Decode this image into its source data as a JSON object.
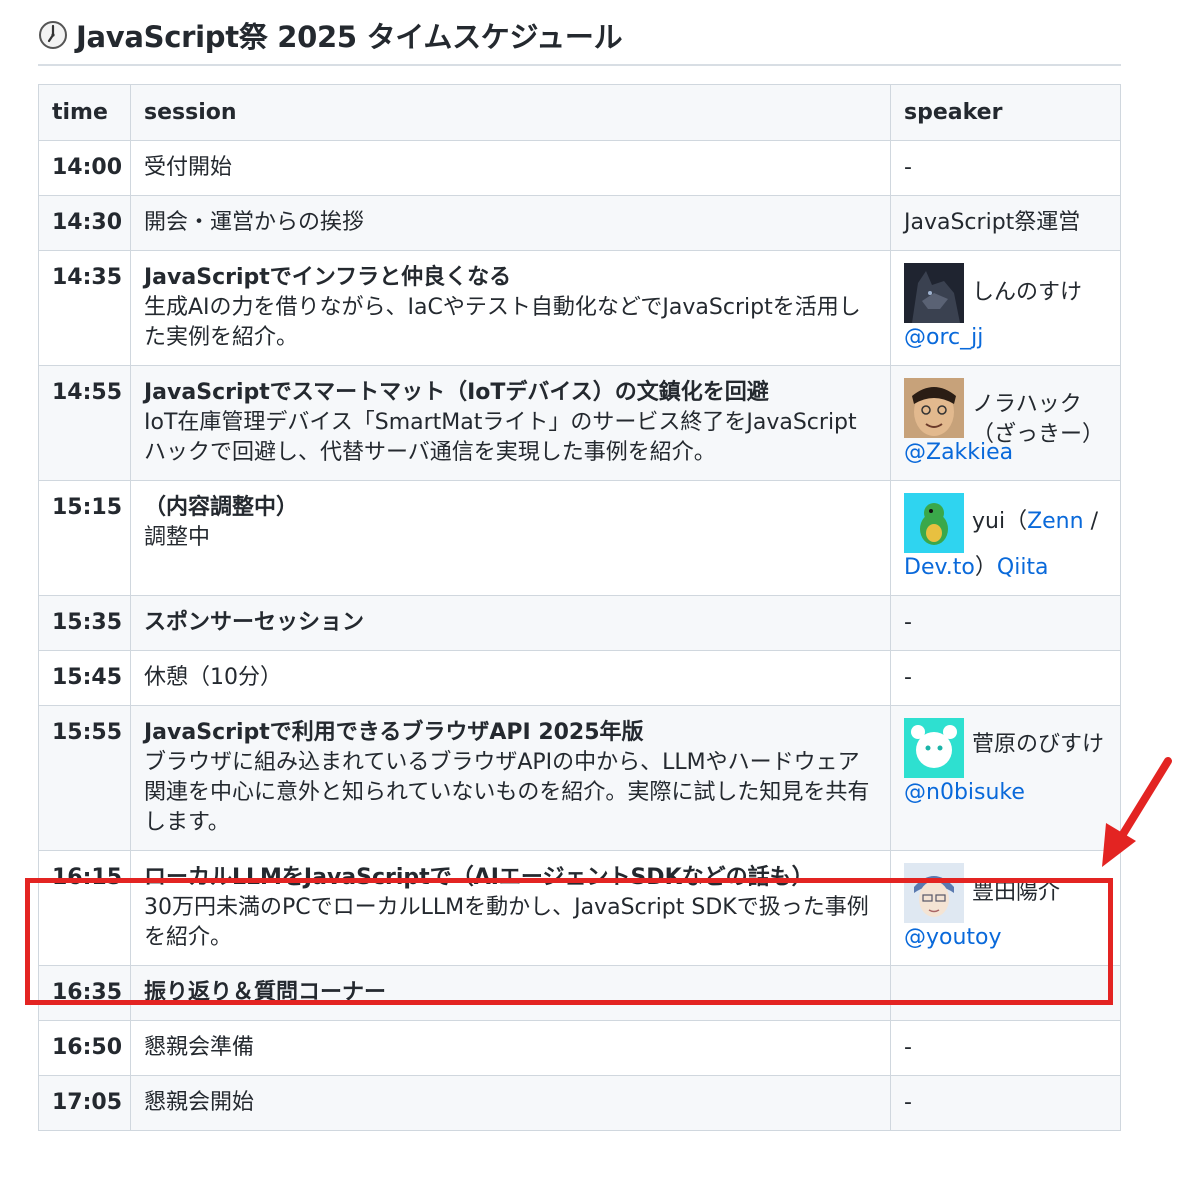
{
  "page": {
    "icon": "clock-icon",
    "title": "JavaScript祭 2025 タイムスケジュール"
  },
  "table": {
    "headers": [
      "time",
      "session",
      "speaker"
    ],
    "rows": [
      {
        "time": "14:00",
        "title": "",
        "desc": "受付開始",
        "speaker": "-"
      },
      {
        "time": "14:30",
        "title": "",
        "desc": "開会・運営からの挨拶",
        "speaker": "JavaScript祭運営"
      },
      {
        "time": "14:35",
        "title": "JavaScriptでインフラと仲良くなる",
        "desc": "生成AIの力を借りながら、IaCやテスト自動化などでJavaScriptを活用した実例を紹介。",
        "speaker": "しんのすけ",
        "handle": "@orc_jj",
        "avatar": "wolf-avatar"
      },
      {
        "time": "14:55",
        "title": "JavaScriptでスマートマット（IoTデバイス）の文鎮化を回避",
        "desc": "IoT在庫管理デバイス「SmartMatライト」のサービス終了をJavaScriptハックで回避し、代替サーバ通信を実現した事例を紹介。",
        "speaker": "ノラハック（ざっきー）",
        "handle": "@Zakkiea",
        "avatar": "man-photo-avatar"
      },
      {
        "time": "15:15",
        "title": "（内容調整中）",
        "desc": "調整中",
        "speaker": "yui（",
        "link1": "Zenn",
        "sep": " / ",
        "link2": "Dev.to",
        "close": "）",
        "link3": "Qiita",
        "avatar": "dinosaur-avatar"
      },
      {
        "time": "15:35",
        "title": "スポンサーセッション",
        "desc": "",
        "speaker": "-"
      },
      {
        "time": "15:45",
        "title": "",
        "desc": "休憩（10分）",
        "speaker": "-"
      },
      {
        "time": "15:55",
        "title": "JavaScriptで利用できるブラウザAPI 2025年版",
        "desc": "ブラウザに組み込まれているブラウザAPIの中から、LLMやハードウェア関連を中心に意外と知られていないものを紹介。実際に試した知見を共有します。",
        "speaker": "菅原のびすけ",
        "handle": "@n0bisuke",
        "avatar": "cat-avatar"
      },
      {
        "time": "16:15",
        "title": "ローカルLLMをJavaScriptで（AIエージェントSDKなどの話も）",
        "desc": "30万円未満のPCでローカルLLMを動かし、JavaScript SDKで扱った事例を紹介。",
        "speaker": "豊田陽介",
        "handle": "@youtoy",
        "avatar": "illustration-avatar"
      },
      {
        "time": "16:35",
        "title": "振り返り＆質問コーナー",
        "desc": "",
        "speaker": ""
      },
      {
        "time": "16:50",
        "title": "",
        "desc": "懇親会準備",
        "speaker": "-"
      },
      {
        "time": "17:05",
        "title": "",
        "desc": "懇親会開始",
        "speaker": "-"
      }
    ]
  },
  "annotation": {
    "highlight_color": "#e32422",
    "highlight_target": "16:15"
  },
  "colors": {
    "link": "#0969da",
    "header_bg": "#f6f8fa",
    "border": "#d0d7de"
  }
}
